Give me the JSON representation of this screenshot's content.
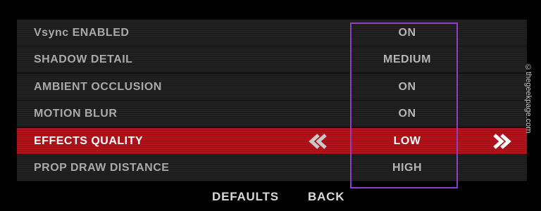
{
  "settings": [
    {
      "label": "Vsync ENABLED",
      "value": "ON"
    },
    {
      "label": "SHADOW DETAIL",
      "value": "MEDIUM"
    },
    {
      "label": "AMBIENT OCCLUSION",
      "value": "ON"
    },
    {
      "label": "MOTION BLUR",
      "value": "ON"
    },
    {
      "label": "EFFECTS QUALITY",
      "value": "LOW",
      "selected": true
    },
    {
      "label": "PROP DRAW DISTANCE",
      "value": "HIGH"
    }
  ],
  "footer": {
    "defaults_label": "DEFAULTS",
    "back_label": "BACK"
  },
  "watermark": "©thegeekpage.com",
  "icons": {
    "left": "double-chevron-left-icon",
    "right": "double-chevron-right-icon"
  },
  "colors": {
    "selected_row": "#b4121a",
    "highlight_box": "#8a3fc4"
  }
}
